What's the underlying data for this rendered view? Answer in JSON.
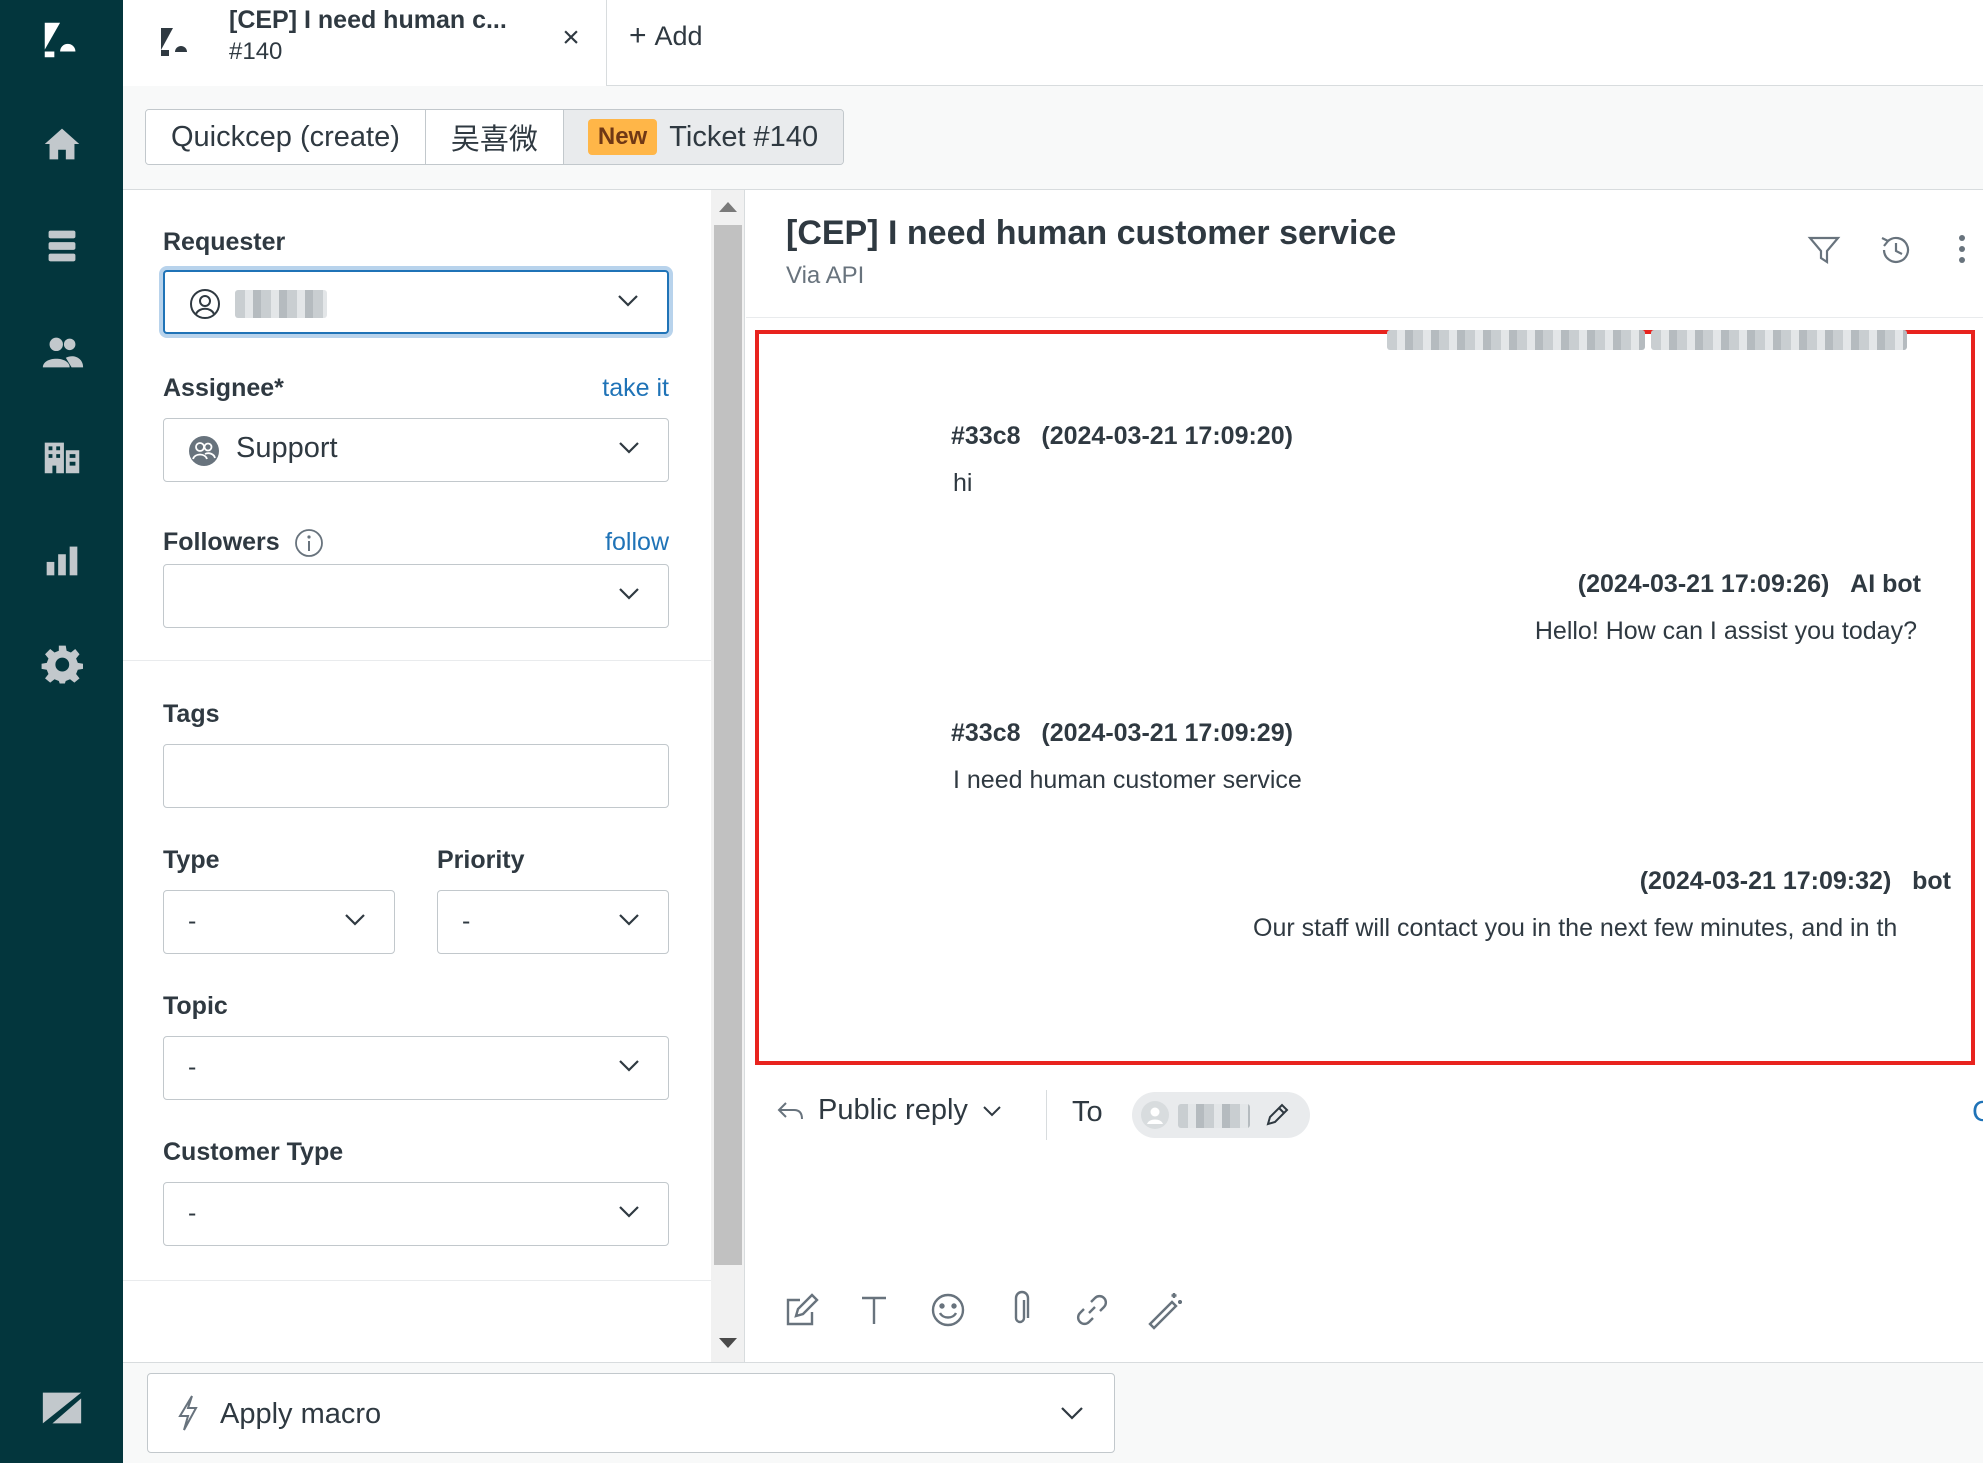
{
  "tabs": {
    "ticket_title": "[CEP] I need human c...",
    "ticket_number": "#140",
    "close_glyph": "×",
    "add_label": "Add",
    "add_glyph": "+"
  },
  "breadcrumb": {
    "items": [
      "Quickcep (create)",
      "吴喜微"
    ],
    "status_badge": "New",
    "current": "Ticket #140"
  },
  "properties": {
    "requester_label": "Requester",
    "assignee_label": "Assignee*",
    "take_it_link": "take it",
    "assignee_value": "Support",
    "followers_label": "Followers",
    "follow_link": "follow",
    "tags_label": "Tags",
    "type_label": "Type",
    "type_value": "-",
    "priority_label": "Priority",
    "priority_value": "-",
    "topic_label": "Topic",
    "topic_value": "-",
    "customer_type_label": "Customer Type",
    "customer_type_value": "-"
  },
  "conversation": {
    "title": "[CEP] I need human customer service",
    "via": "Via API",
    "messages": [
      {
        "author": "#33c8",
        "time": "(2024-03-21 17:09:20)",
        "text": "hi",
        "side": "left"
      },
      {
        "author": "AI bot",
        "time": "(2024-03-21 17:09:26)",
        "text": "Hello! How can I assist you today?",
        "side": "right"
      },
      {
        "author": "#33c8",
        "time": "(2024-03-21 17:09:29)",
        "text": "I need human customer service",
        "side": "left"
      },
      {
        "author": "bot",
        "time": "(2024-03-21 17:09:32)",
        "text": "Our staff will contact you in the next few minutes, and in th",
        "side": "right"
      }
    ]
  },
  "reply": {
    "type_label": "Public reply",
    "to_label": "To",
    "cc_label": "C"
  },
  "macro": {
    "label": "Apply macro"
  },
  "colors": {
    "nav_bg": "#03363d",
    "link": "#1f73b7",
    "highlight_border": "#e8231e",
    "new_badge": "#ffb648"
  }
}
